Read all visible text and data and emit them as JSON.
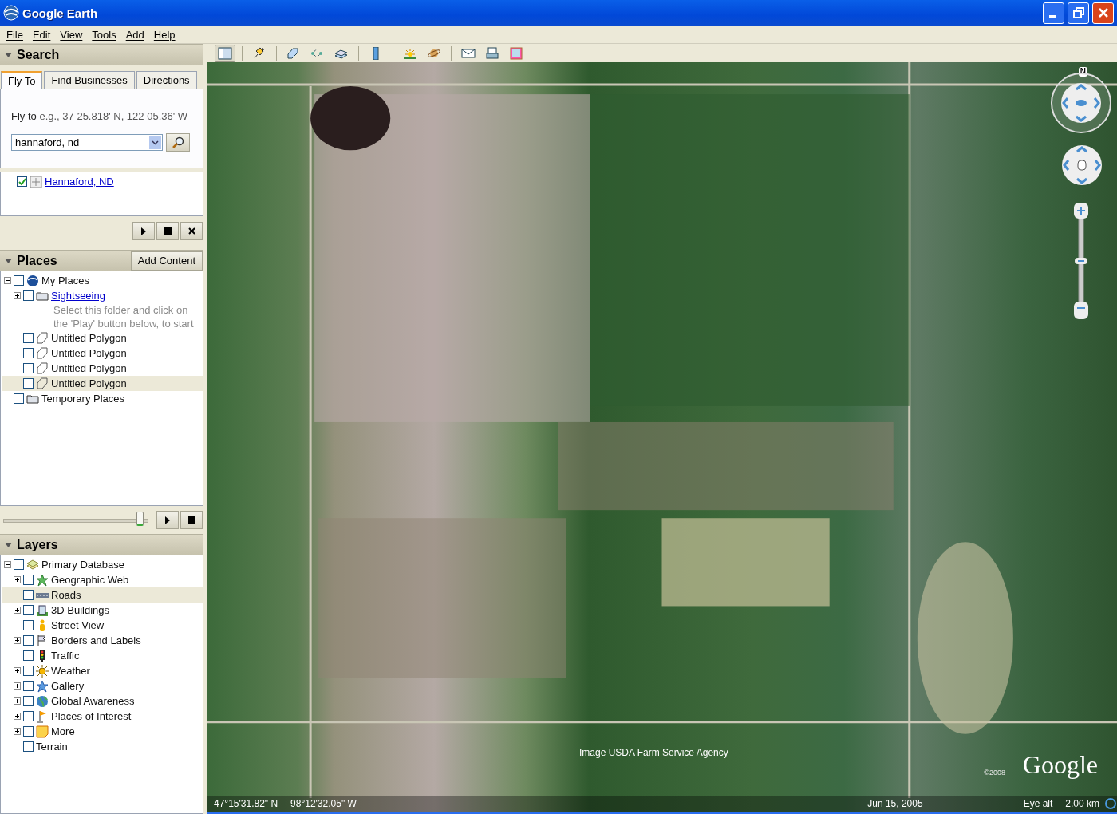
{
  "window": {
    "title": "Google Earth"
  },
  "menu": [
    {
      "label": "File"
    },
    {
      "label": "Edit"
    },
    {
      "label": "View"
    },
    {
      "label": "Tools"
    },
    {
      "label": "Add"
    },
    {
      "label": "Help"
    }
  ],
  "toolbar": [
    {
      "kind": "sidebar",
      "selected": true
    },
    {
      "kind": "placemark",
      "selected": false
    },
    {
      "kind": "polygon",
      "selected": false
    },
    {
      "kind": "path",
      "selected": false
    },
    {
      "kind": "overlay",
      "selected": false
    },
    {
      "kind": "ruler",
      "selected": false
    },
    {
      "kind": "sun",
      "selected": false
    },
    {
      "kind": "planet",
      "selected": false
    },
    {
      "kind": "email",
      "selected": false
    },
    {
      "kind": "print",
      "selected": false
    },
    {
      "kind": "maps",
      "selected": false
    }
  ],
  "search": {
    "title": "Search",
    "expanded": true,
    "tabs": [
      {
        "label": "Fly To",
        "selected": true
      },
      {
        "label": "Find Businesses",
        "selected": false
      },
      {
        "label": "Directions",
        "selected": false
      }
    ],
    "hint_label": "Fly to",
    "hint": "e.g., 37 25.818' N, 122 05.36' W",
    "query": "hannaford, nd",
    "results": [
      {
        "label": "Hannaford, ND",
        "checked": true
      }
    ]
  },
  "places": {
    "title": "Places",
    "expanded": true,
    "add_button": "Add Content",
    "tour_slider": {
      "level": 0.97
    },
    "tree": [
      {
        "label": "My Places",
        "kind": "globe",
        "checked": false,
        "expanded": true,
        "selected": false,
        "children": [
          {
            "label": "Sightseeing",
            "kind": "folder",
            "checked": false,
            "expanded": false,
            "selected": false,
            "link": true,
            "description": "Select this folder and click on the 'Play' button below, to start"
          },
          {
            "label": "Untitled Polygon",
            "kind": "polygon",
            "checked": false,
            "selected": false
          },
          {
            "label": "Untitled Polygon",
            "kind": "polygon",
            "checked": false,
            "selected": false
          },
          {
            "label": "Untitled Polygon",
            "kind": "polygon",
            "checked": false,
            "selected": false
          },
          {
            "label": "Untitled Polygon",
            "kind": "polygon",
            "checked": false,
            "selected": true
          }
        ]
      },
      {
        "label": "Temporary Places",
        "kind": "folder",
        "checked": false,
        "selected": false
      }
    ]
  },
  "layers": {
    "title": "Layers",
    "expanded": true,
    "tree": [
      {
        "label": "Primary Database",
        "kind": "layers",
        "checked": false,
        "expanded": true,
        "selected": false,
        "children": [
          {
            "label": "Geographic Web",
            "kind": "star",
            "checked": false,
            "expanded": false,
            "selected": false
          },
          {
            "label": "Roads",
            "kind": "road",
            "checked": false,
            "selected": true
          },
          {
            "label": "3D Buildings",
            "kind": "building",
            "checked": false,
            "expanded": false,
            "selected": false
          },
          {
            "label": "Street View",
            "kind": "person",
            "checked": false,
            "selected": false
          },
          {
            "label": "Borders and Labels",
            "kind": "flag",
            "checked": false,
            "expanded": false,
            "selected": false
          },
          {
            "label": "Traffic",
            "kind": "traffic",
            "checked": false,
            "selected": false
          },
          {
            "label": "Weather",
            "kind": "sun",
            "checked": false,
            "expanded": false,
            "selected": false
          },
          {
            "label": "Gallery",
            "kind": "bluestar",
            "checked": false,
            "expanded": false,
            "selected": false
          },
          {
            "label": "Global Awareness",
            "kind": "earth",
            "checked": false,
            "expanded": false,
            "selected": false
          },
          {
            "label": "Places of Interest",
            "kind": "pinflag",
            "checked": false,
            "expanded": false,
            "selected": false
          },
          {
            "label": "More",
            "kind": "note",
            "checked": false,
            "expanded": false,
            "selected": false
          },
          {
            "label": "Terrain",
            "kind": "none",
            "checked": false,
            "selected": false
          }
        ]
      }
    ]
  },
  "map": {
    "compass": "N",
    "zoom_slider": {
      "level": 0.5
    },
    "attribution": "Image USDA Farm Service Agency",
    "copyright": "©2008",
    "logo": "Google",
    "status": {
      "latitude": "47°15'31.82\" N",
      "longitude": "98°12'32.05\" W",
      "date": "Jun 15, 2005",
      "eye_alt_label": "Eye alt",
      "eye_alt": "2.00 km"
    }
  }
}
